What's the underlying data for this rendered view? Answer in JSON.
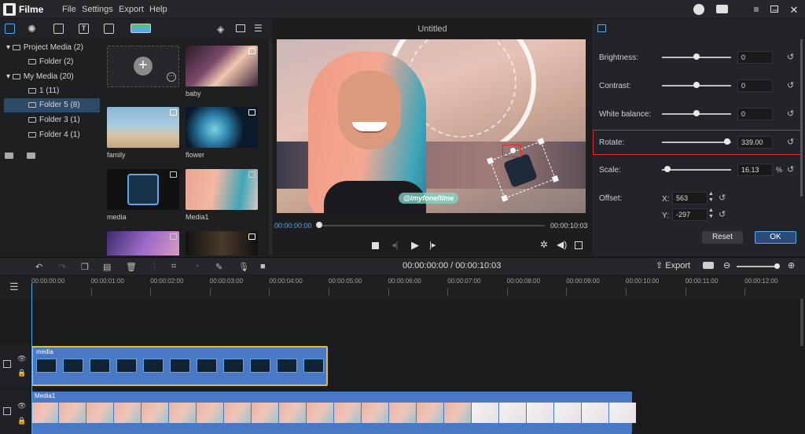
{
  "app": {
    "name": "Filme",
    "menu": [
      "File",
      "Settings",
      "Export",
      "Help"
    ]
  },
  "tree": [
    {
      "label": "Project Media (2)",
      "level": 0,
      "expanded": true
    },
    {
      "label": "Folder (2)",
      "level": 1
    },
    {
      "label": "My Media (20)",
      "level": 0,
      "expanded": true
    },
    {
      "label": "1 (11)",
      "level": 1
    },
    {
      "label": "Folder 5 (8)",
      "level": 1,
      "selected": true
    },
    {
      "label": "Folder 3 (1)",
      "level": 1
    },
    {
      "label": "Folder 4 (1)",
      "level": 1
    }
  ],
  "media": [
    {
      "label": "baby",
      "type": "image"
    },
    {
      "label": "family",
      "type": "image"
    },
    {
      "label": "flower",
      "type": "image"
    },
    {
      "label": "media",
      "type": "video"
    },
    {
      "label": "Media1",
      "type": "video"
    }
  ],
  "preview": {
    "title": "Untitled",
    "watermark": "@imyfonefilme",
    "time_current": "00:00:00:00",
    "time_total": "00:00:10:03",
    "progress": 0
  },
  "props": {
    "brightness": {
      "label": "Brightness:",
      "value": "0",
      "level": 0.5
    },
    "contrast": {
      "label": "Contrast:",
      "value": "0",
      "level": 0.5
    },
    "white_balance": {
      "label": "White balance:",
      "value": "0",
      "level": 0.5
    },
    "rotate": {
      "label": "Rotate:",
      "value": "339.00",
      "level": 0.94
    },
    "scale": {
      "label": "Scale:",
      "value": "16.13",
      "unit": "%",
      "level": 0.08
    },
    "offset": {
      "label": "Offset:",
      "x_label": "X:",
      "x": "563",
      "y_label": "Y:",
      "y": "-297"
    },
    "reset_label": "Reset",
    "ok_label": "OK"
  },
  "toolbar": {
    "time": "00:00:00:00 / 00:00:10:03",
    "export_label": "Export"
  },
  "timeline": {
    "ticks": [
      "00:00:00:00",
      "00:00:01:00",
      "00:00:02:00",
      "00:00:03:00",
      "00:00:04:00",
      "00:00:05:00",
      "00:00:06:00",
      "00:00:07:00",
      "00:00:08:00",
      "00:00:09:00",
      "00:00:10:00",
      "00:00:11:00",
      "00:00:12:00"
    ],
    "clips": [
      {
        "label": "media"
      },
      {
        "label": "Media1"
      }
    ]
  },
  "colors": {
    "accent": "#5aa9e6",
    "highlight": "#e02a2a",
    "clip": "#4a78c4",
    "selected_border": "#e2b93b"
  }
}
